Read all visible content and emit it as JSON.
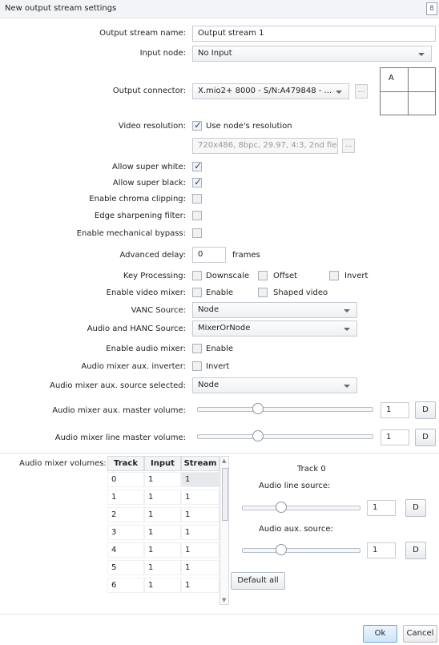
{
  "window": {
    "title": "New output stream settings",
    "close": "8"
  },
  "form": {
    "output_stream_name": {
      "label": "Output stream name:",
      "value": "Output stream 1"
    },
    "input_node": {
      "label": "Input node:",
      "value": "No Input"
    },
    "output_connector": {
      "label": "Output connector:",
      "value": "X.mio2+ 8000 - S/N:A479848 - ...",
      "ellipsis": "..."
    },
    "video_resolution": {
      "label": "Video resolution:",
      "checkbox_label": "Use node's resolution",
      "checked": true,
      "value": "720x486, 8bpc, 29.97, 4:3, 2nd fie",
      "ellipsis": "..."
    },
    "allow_super_white": {
      "label": "Allow super white:",
      "checked": true
    },
    "allow_super_black": {
      "label": "Allow super black:",
      "checked": true
    },
    "enable_chroma_clipping": {
      "label": "Enable chroma clipping:",
      "checked": false
    },
    "edge_sharpening_filter": {
      "label": "Edge sharpening filter:",
      "checked": false
    },
    "enable_mechanical_bypass": {
      "label": "Enable mechanical bypass:",
      "checked": false
    },
    "advanced_delay": {
      "label": "Advanced delay:",
      "value": "0",
      "unit": "frames"
    },
    "key_processing": {
      "label": "Key Processing:",
      "options": [
        "Downscale",
        "Offset",
        "Invert"
      ]
    },
    "enable_video_mixer": {
      "label": "Enable video mixer:",
      "options": [
        "Enable",
        "Shaped video"
      ]
    },
    "vanc_source": {
      "label": "VANC Source:",
      "value": "Node"
    },
    "audio_hanc_source": {
      "label": "Audio and HANC Source:",
      "value": "MixerOrNode"
    },
    "enable_audio_mixer": {
      "label": "Enable audio mixer:",
      "option": "Enable"
    },
    "audio_mixer_aux_inverter": {
      "label": "Audio mixer aux. inverter:",
      "option": "Invert"
    },
    "audio_mixer_aux_source_selected": {
      "label": "Audio mixer aux. source selected:",
      "value": "Node"
    },
    "audio_mixer_aux_master_volume": {
      "label": "Audio mixer aux. master volume:",
      "value": "1",
      "button": "D"
    },
    "audio_mixer_line_master_volume": {
      "label": "Audio mixer line master volume:",
      "value": "1",
      "button": "D"
    }
  },
  "connector_grid": {
    "label": "A"
  },
  "audio_mixer": {
    "label": "Audio mixer volumes:",
    "columns": [
      "Track",
      "Input",
      "Stream"
    ],
    "rows": [
      [
        "0",
        "1",
        "1"
      ],
      [
        "1",
        "1",
        "1"
      ],
      [
        "2",
        "1",
        "1"
      ],
      [
        "3",
        "1",
        "1"
      ],
      [
        "4",
        "1",
        "1"
      ],
      [
        "5",
        "1",
        "1"
      ],
      [
        "6",
        "1",
        "1"
      ]
    ],
    "track_title": "Track 0",
    "line_source_label": "Audio line source:",
    "line_value": "1",
    "aux_source_label": "Audio aux. source:",
    "aux_value": "1",
    "d_button": "D",
    "default_all": "Default all"
  },
  "footer": {
    "ok": "Ok",
    "cancel": "Cancel"
  }
}
